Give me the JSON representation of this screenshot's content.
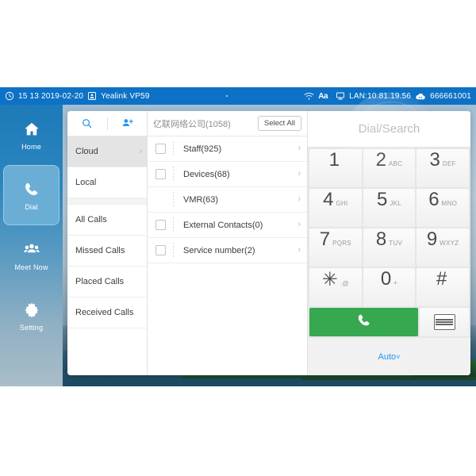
{
  "statusbar": {
    "clock_icon": "clock-icon",
    "time": "15 13 2019-02-20",
    "device_icon": "device-icon",
    "device_name": "Yealink VP59",
    "wifi_icon": "wifi-icon",
    "input_method_icon": "Aa",
    "lan_icon": "network-icon",
    "lan_text": "LAN:10.81.19.56",
    "cloud_icon": "cloud-icon",
    "account_number": "666661001",
    "bg_color": "#0d72c5"
  },
  "sidebar": {
    "items": [
      {
        "label": "Home",
        "icon": "home-icon",
        "selected": false
      },
      {
        "label": "Dial",
        "icon": "phone-icon",
        "selected": true
      },
      {
        "label": "Meet Now",
        "icon": "group-icon",
        "selected": false
      },
      {
        "label": "Setting",
        "icon": "gear-icon",
        "selected": false
      }
    ]
  },
  "directory": {
    "tools": [
      {
        "name": "search-icon",
        "label": "Search"
      },
      {
        "name": "add-contact-icon",
        "label": "Add Contact"
      }
    ],
    "groups": [
      {
        "label": "Cloud",
        "active": true,
        "chevron": "›"
      },
      {
        "label": "Local",
        "active": false,
        "chevron": ""
      }
    ],
    "history": [
      {
        "label": "All Calls"
      },
      {
        "label": "Missed Calls"
      },
      {
        "label": "Placed Calls"
      },
      {
        "label": "Received Calls"
      }
    ]
  },
  "contacts": {
    "header_title": "亿联网络公司(1058)",
    "select_all_label": "Select All",
    "rows": [
      {
        "label": "Staff(925)",
        "checkbox": true,
        "chevron": "›"
      },
      {
        "label": "Devices(68)",
        "checkbox": true,
        "chevron": "›"
      },
      {
        "label": "VMR(63)",
        "checkbox": false,
        "chevron": "›"
      },
      {
        "label": "External Contacts(0)",
        "checkbox": true,
        "chevron": "›"
      },
      {
        "label": "Service number(2)",
        "checkbox": true,
        "chevron": "›"
      }
    ]
  },
  "dialpad": {
    "field_placeholder": "Dial/Search",
    "field_value": "",
    "keys": [
      {
        "digit": "1",
        "sub": ""
      },
      {
        "digit": "2",
        "sub": "ABC"
      },
      {
        "digit": "3",
        "sub": "DEF"
      },
      {
        "digit": "4",
        "sub": "GHI"
      },
      {
        "digit": "5",
        "sub": "JKL"
      },
      {
        "digit": "6",
        "sub": "MNO"
      },
      {
        "digit": "7",
        "sub": "PQRS"
      },
      {
        "digit": "8",
        "sub": "TUV"
      },
      {
        "digit": "9",
        "sub": "WXYZ"
      },
      {
        "digit": "✳",
        "sub": ".@"
      },
      {
        "digit": "0",
        "sub": "+"
      },
      {
        "digit": "#",
        "sub": ""
      }
    ],
    "call_button_icon": "phone-icon",
    "call_button_color": "#36a84f",
    "keyboard_button_icon": "keyboard-icon",
    "mode_label": "Auto",
    "mode_chevron": "˅",
    "mode_color": "#2196f3"
  }
}
